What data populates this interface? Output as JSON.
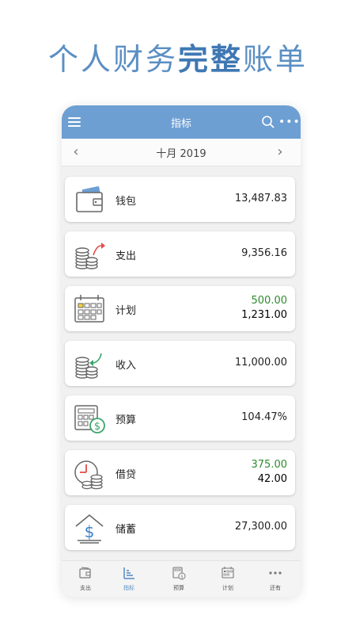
{
  "headline": {
    "part1": "个人财务",
    "part2": "完整",
    "part3": "账单"
  },
  "appbar": {
    "title": "指标"
  },
  "month": {
    "label": "十月 2019"
  },
  "cards": [
    {
      "label": "钱包",
      "value": "13,487.83",
      "icon": "wallet-icon"
    },
    {
      "label": "支出",
      "value": "9,356.16",
      "icon": "coins-out-icon"
    },
    {
      "label": "计划",
      "value_planned": "500.00",
      "value_actual": "1,231.00",
      "icon": "calendar-icon"
    },
    {
      "label": "收入",
      "value": "11,000.00",
      "icon": "coins-in-icon"
    },
    {
      "label": "预算",
      "value": "104.47%",
      "icon": "calculator-icon"
    },
    {
      "label": "借贷",
      "value_planned": "375.00",
      "value_actual": "42.00",
      "icon": "clock-coins-icon"
    },
    {
      "label": "储蓄",
      "value": "27,300.00",
      "icon": "savings-house-icon"
    }
  ],
  "tabs": [
    {
      "label": "支出",
      "icon": "expense-tab-icon"
    },
    {
      "label": "指标",
      "icon": "chart-tab-icon",
      "active": true
    },
    {
      "label": "预算",
      "icon": "budget-tab-icon"
    },
    {
      "label": "计划",
      "icon": "calendar-tab-icon"
    },
    {
      "label": "还有",
      "icon": "more-tab-icon"
    }
  ],
  "colors": {
    "accent": "#6d9fd3",
    "positive": "#2e8a2e",
    "headline": "#5b8fc4"
  }
}
